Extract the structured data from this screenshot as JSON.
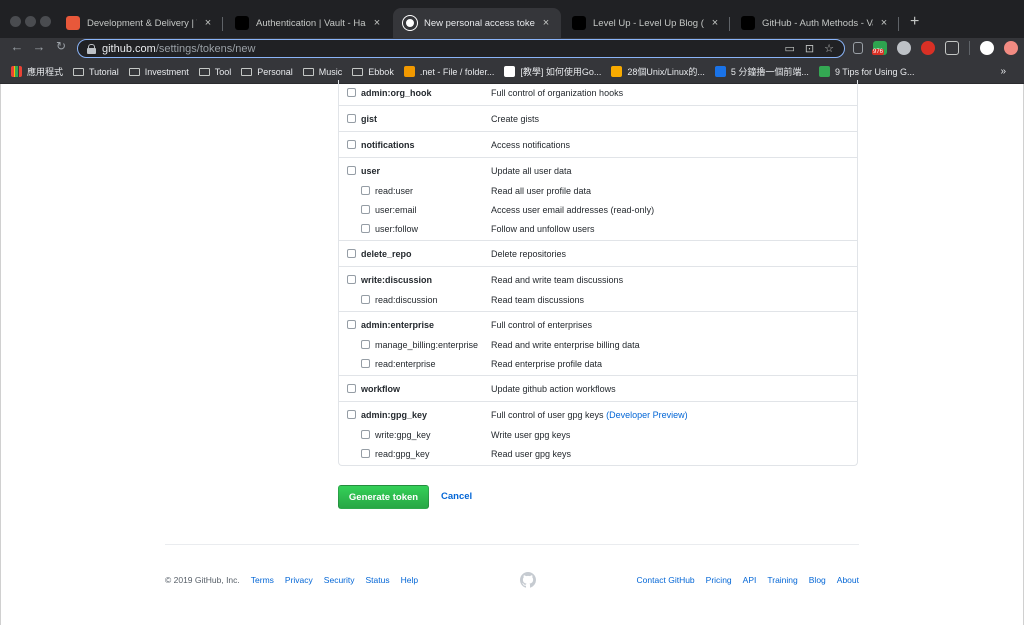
{
  "browser": {
    "tabs": [
      {
        "title": "Development & Delivery | Trello",
        "favicon_color": "#e8583a",
        "active": false
      },
      {
        "title": "Authentication | Vault - HashiCorp",
        "favicon_color": "#000000",
        "active": false
      },
      {
        "title": "New personal access token",
        "favicon_color": "#ffffff",
        "active": true
      },
      {
        "title": "Level Up - Level Up Blog (https://",
        "favicon_color": "#000000",
        "active": false
      },
      {
        "title": "GitHub - Auth Methods - Vault",
        "favicon_color": "#000000",
        "active": false
      }
    ],
    "close_glyph": "×",
    "new_tab_glyph": "+",
    "url_host": "github.com",
    "url_path": "/settings/tokens/new",
    "bookmarks": [
      {
        "label": "應用程式",
        "type": "apps"
      },
      {
        "label": "Tutorial",
        "type": "folder"
      },
      {
        "label": "Investment",
        "type": "folder"
      },
      {
        "label": "Tool",
        "type": "folder"
      },
      {
        "label": "Personal",
        "type": "folder"
      },
      {
        "label": "Music",
        "type": "folder"
      },
      {
        "label": "Ebbok",
        "type": "folder"
      },
      {
        "label": ".net - File / folder...",
        "type": "link"
      },
      {
        "label": "[教學] 如何使用Go...",
        "type": "link"
      },
      {
        "label": "28個Unix/Linux的...",
        "type": "link"
      },
      {
        "label": "5 分鐘擼一個前端...",
        "type": "link"
      },
      {
        "label": "9 Tips for Using G...",
        "type": "link"
      }
    ],
    "bookmarks_more": "»",
    "ext_badge": "976"
  },
  "scopes": [
    {
      "name": "admin:org_hook",
      "desc": "Full control of organization hooks",
      "subs": []
    },
    {
      "name": "gist",
      "desc": "Create gists",
      "subs": []
    },
    {
      "name": "notifications",
      "desc": "Access notifications",
      "subs": []
    },
    {
      "name": "user",
      "desc": "Update all user data",
      "subs": [
        {
          "name": "read:user",
          "desc": "Read all user profile data"
        },
        {
          "name": "user:email",
          "desc": "Access user email addresses (read-only)"
        },
        {
          "name": "user:follow",
          "desc": "Follow and unfollow users"
        }
      ]
    },
    {
      "name": "delete_repo",
      "desc": "Delete repositories",
      "subs": []
    },
    {
      "name": "write:discussion",
      "desc": "Read and write team discussions",
      "subs": [
        {
          "name": "read:discussion",
          "desc": "Read team discussions"
        }
      ]
    },
    {
      "name": "admin:enterprise",
      "desc": "Full control of enterprises",
      "subs": [
        {
          "name": "manage_billing:enterprise",
          "desc": "Read and write enterprise billing data"
        },
        {
          "name": "read:enterprise",
          "desc": "Read enterprise profile data"
        }
      ]
    },
    {
      "name": "workflow",
      "desc": "Update github action workflows",
      "subs": []
    },
    {
      "name": "admin:gpg_key",
      "desc": "Full control of user gpg keys",
      "link": "(Developer Preview)",
      "subs": [
        {
          "name": "write:gpg_key",
          "desc": "Write user gpg keys"
        },
        {
          "name": "read:gpg_key",
          "desc": "Read user gpg keys"
        }
      ]
    }
  ],
  "actions": {
    "generate_label": "Generate token",
    "cancel_label": "Cancel"
  },
  "footer": {
    "copyright": "© 2019 GitHub, Inc.",
    "left_links": [
      "Terms",
      "Privacy",
      "Security",
      "Status",
      "Help"
    ],
    "right_links": [
      "Contact GitHub",
      "Pricing",
      "API",
      "Training",
      "Blog",
      "About"
    ]
  }
}
